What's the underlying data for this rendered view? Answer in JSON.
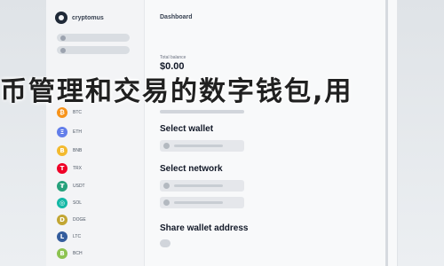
{
  "sidebar": {
    "brand_name": "cryptomus",
    "pills": [
      "",
      ""
    ],
    "coins": [
      {
        "symbol": "₿",
        "label": "BTC",
        "color": "#f7931a"
      },
      {
        "symbol": "Ξ",
        "label": "ETH",
        "color": "#627eea"
      },
      {
        "symbol": "B",
        "label": "BNB",
        "color": "#f3ba2f"
      },
      {
        "symbol": "T",
        "label": "TRX",
        "color": "#ef0027"
      },
      {
        "symbol": "₮",
        "label": "USDT",
        "color": "#26a17b"
      },
      {
        "symbol": "◎",
        "label": "SOL",
        "color": "#14b8a6"
      },
      {
        "symbol": "D",
        "label": "DOGE",
        "color": "#c2a633"
      },
      {
        "symbol": "L",
        "label": "LTC",
        "color": "#345d9d"
      },
      {
        "symbol": "B",
        "label": "BCH",
        "color": "#8dc351"
      }
    ]
  },
  "main": {
    "title": "Dashboard",
    "balance_label": "Total balance",
    "balance": "$0.00",
    "select_wallet": "Select wallet",
    "select_network": "Select network",
    "share_wallet": "Share wallet address"
  },
  "overlay": {
    "text": "币管理和交易的数字钱包,用"
  }
}
